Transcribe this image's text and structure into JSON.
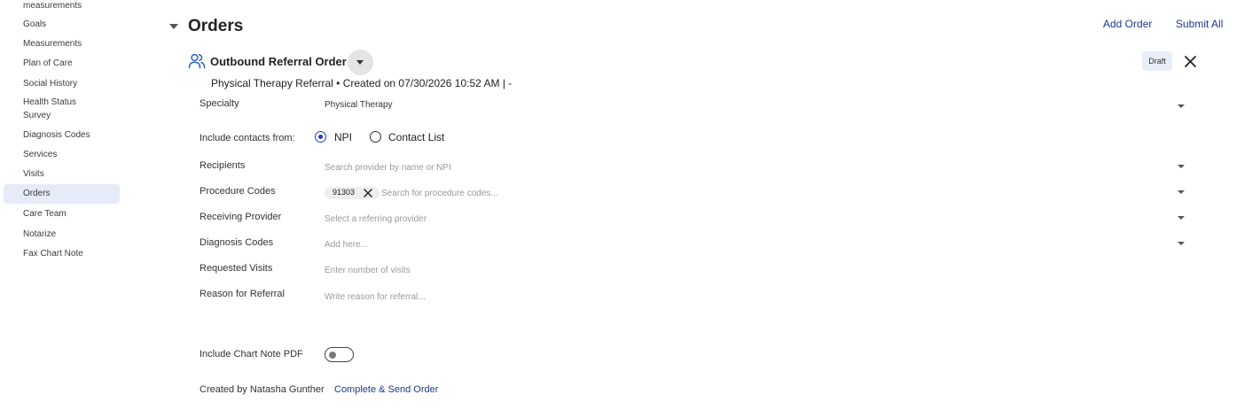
{
  "sidebar": {
    "items": [
      {
        "label": "measurements",
        "active": false
      },
      {
        "label": "Goals",
        "active": false
      },
      {
        "label": "Measurements",
        "active": false
      },
      {
        "label": "Plan of Care",
        "active": false
      },
      {
        "label": "Social History",
        "active": false
      },
      {
        "label": "Health Status Survey",
        "active": false
      },
      {
        "label": "Diagnosis Codes",
        "active": false
      },
      {
        "label": "Services",
        "active": false
      },
      {
        "label": "Visits",
        "active": false
      },
      {
        "label": "Orders",
        "active": true
      },
      {
        "label": "Care Team",
        "active": false
      },
      {
        "label": "Notarize",
        "active": false
      },
      {
        "label": "Fax Chart Note",
        "active": false
      }
    ]
  },
  "header": {
    "title": "Orders",
    "add_order": "Add Order",
    "submit_all": "Submit All"
  },
  "order": {
    "title": "Outbound Referral Order",
    "status": "Draft",
    "subtitle": "Physical Therapy Referral • Created on 07/30/2026 10:52 AM | -",
    "icon": "users-icon"
  },
  "form": {
    "specialty": {
      "label": "Specialty",
      "value": "Physical Therapy"
    },
    "contacts": {
      "label": "Include contacts from:",
      "options": [
        {
          "label": "NPI",
          "checked": true
        },
        {
          "label": "Contact List",
          "checked": false
        }
      ]
    },
    "recipients": {
      "label": "Recipients",
      "placeholder": "Search provider by name or NPI"
    },
    "procedure_codes": {
      "label": "Procedure Codes",
      "chips": [
        "91303"
      ],
      "placeholder": "Search for procedure codes..."
    },
    "receiving_provider": {
      "label": "Receiving Provider",
      "placeholder": "Select a referring provider"
    },
    "diagnosis_codes": {
      "label": "Diagnosis Codes",
      "placeholder": "Add here..."
    },
    "requested_visits": {
      "label": "Requested Visits",
      "placeholder": "Enter number of visits"
    },
    "reason": {
      "label": "Reason for Referral",
      "placeholder": "Write reason for referral..."
    },
    "chart_note": {
      "label": "Include Chart Note PDF",
      "enabled": false
    }
  },
  "footer": {
    "created_by": "Created by Natasha Gunther",
    "send": "Complete & Send Order"
  },
  "colors": {
    "accent": "#1c3cc8",
    "link": "#1b3a8f",
    "active_nav_bg": "#e6ebf7",
    "badge_bg": "#e8edf7"
  }
}
